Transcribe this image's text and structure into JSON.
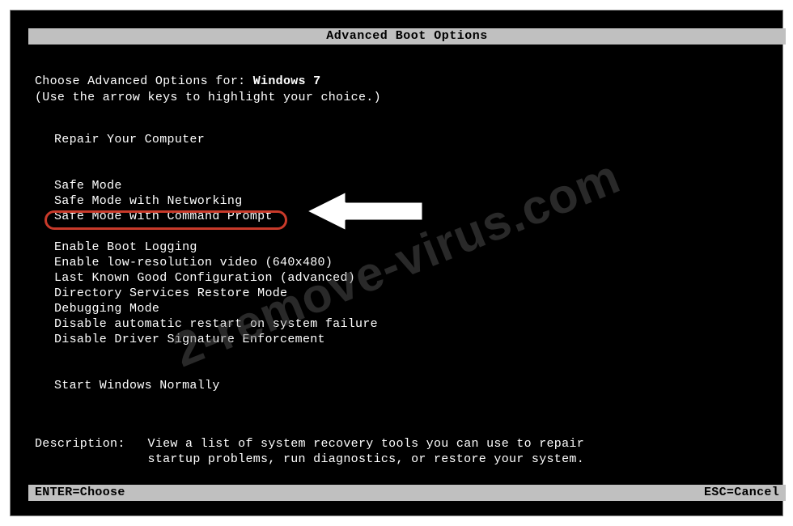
{
  "title": "Advanced Boot Options",
  "prompt": {
    "prefix": "Choose Advanced Options for: ",
    "os": "Windows 7",
    "hint": "(Use the arrow keys to highlight your choice.)"
  },
  "options": {
    "repair": "Repair Your Computer",
    "safe": "Safe Mode",
    "safe_net": "Safe Mode with Networking",
    "safe_cmd": "Safe Mode with Command Prompt",
    "boot_log": "Enable Boot Logging",
    "lowres": "Enable low-resolution video (640x480)",
    "lkg": "Last Known Good Configuration (advanced)",
    "dsrm": "Directory Services Restore Mode",
    "debug": "Debugging Mode",
    "no_restart": "Disable automatic restart on system failure",
    "no_sig": "Disable Driver Signature Enforcement",
    "normal": "Start Windows Normally"
  },
  "description": {
    "label": "Description:   ",
    "line1": "View a list of system recovery tools you can use to repair",
    "line2": "               startup problems, run diagnostics, or restore your system."
  },
  "footer": {
    "enter": "ENTER=Choose",
    "esc": "ESC=Cancel"
  },
  "watermark": "2-remove-virus.com"
}
